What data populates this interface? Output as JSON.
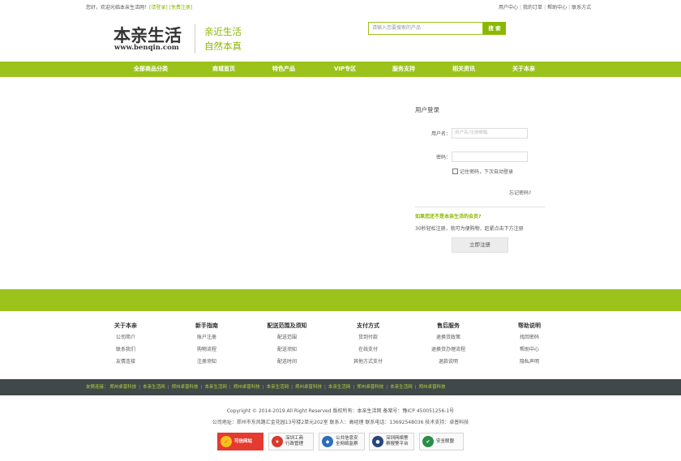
{
  "topbar": {
    "welcome": "您好，欢迎光临本亲生活网！",
    "login_link": "[请登录]",
    "register_link": "[免费注册]",
    "links": [
      "用户中心",
      "我的订单",
      "帮助中心",
      "联系方式"
    ]
  },
  "header": {
    "logo_cn": "本亲生活",
    "logo_en": "www.benqin.com",
    "slogan_line1": "亲近生活",
    "slogan_line2": "自然本真",
    "search_placeholder": "请输入您要搜索的产品",
    "search_button": "搜 索"
  },
  "nav": {
    "items": [
      "全部商品分类",
      "商城首页",
      "特色产品",
      "VIP专区",
      "服务支持",
      "相关资讯",
      "关于本亲"
    ]
  },
  "login": {
    "title": "用户登录",
    "username_label": "用户名：",
    "username_placeholder": "用户名/注册邮箱",
    "password_label": "密码：",
    "remember_label": "记住密码，下次自动登录",
    "forgot": "忘记密码?",
    "not_member": "如果您还不是本亲生活的会员?",
    "register_tip": "30秒轻松注册，就可为便购物，赶紧点击下方注册",
    "register_button": "立即注册"
  },
  "footer": {
    "columns": [
      {
        "title": "关于本亲",
        "links": [
          "公司简介",
          "联系我们",
          "友情连接"
        ]
      },
      {
        "title": "新手指南",
        "links": [
          "账户注册",
          "购物流程",
          "注册须知"
        ]
      },
      {
        "title": "配送范围及须知",
        "links": [
          "配送范围",
          "配送须知",
          "配送时间"
        ]
      },
      {
        "title": "支付方式",
        "links": [
          "货到付款",
          "在线支付",
          "其他方式支付"
        ]
      },
      {
        "title": "售后服务",
        "links": [
          "退换货政策",
          "退换货办理流程",
          "退款说明"
        ]
      },
      {
        "title": "帮助说明",
        "links": [
          "找回密码",
          "帮助中心",
          "隐私声明"
        ]
      }
    ],
    "friends_label": "友情连接：",
    "friends": [
      "郑州卓普科技",
      "本亲生活网",
      "郑州卓普科技",
      "本亲生活网",
      "郑州卓普科技",
      "本亲生活网",
      "郑州卓普科技",
      "本亲生活网",
      "郑州卓普科技",
      "本亲生活网",
      "郑州卓普科技"
    ],
    "copyright": "Copyright © 2014-2019 All Right Reserved 版权所有：本亲生活网 备案号：豫ICP 450051256-1号",
    "address": "公司地址：郑州市东风路汇金花园13号楼2单元202室 联系人：高经理 联系电话：13692548036 技术支持：卓普科技",
    "badges": [
      {
        "icon": "red-shield-icon",
        "line1": "可信网站",
        "line2": ""
      },
      {
        "icon": "police-badge-icon",
        "line1": "深圳工商",
        "line2": "行政管理"
      },
      {
        "icon": "public-security-icon",
        "line1": "公共信息安",
        "line2": "全网络监察"
      },
      {
        "icon": "cyber-police-icon",
        "line1": "深圳网络警",
        "line2": "察报警平台"
      },
      {
        "icon": "safety-alliance-icon",
        "line1": "安全联盟",
        "line2": ""
      }
    ]
  }
}
